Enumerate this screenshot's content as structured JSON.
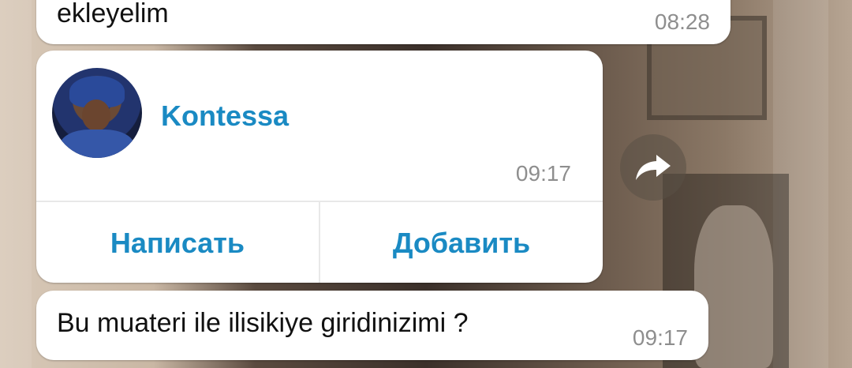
{
  "messages": [
    {
      "text": "ekleyelim",
      "time": "08:28"
    },
    {
      "contact": {
        "name": "Kontessa",
        "time": "09:17",
        "actions": [
          "Написать",
          "Добавить"
        ]
      }
    },
    {
      "text": "Bu muateri ile ilisikiye giridinizimi ?",
      "time": "09:17"
    }
  ],
  "icons": {
    "share": "share-arrow-icon"
  }
}
